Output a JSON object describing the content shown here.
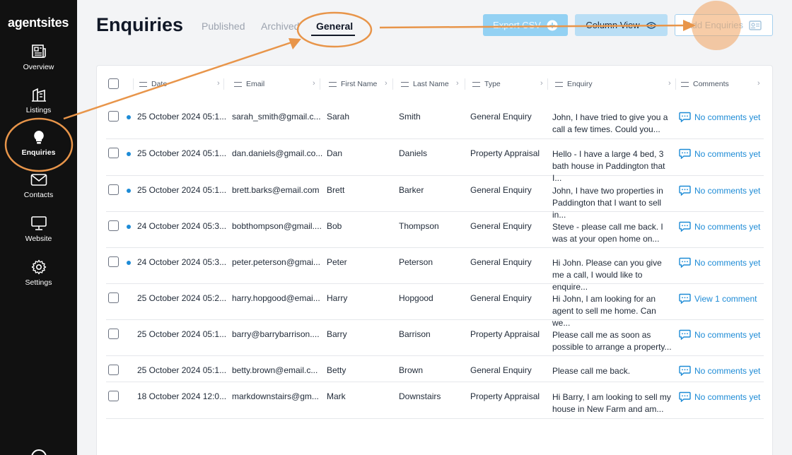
{
  "app": {
    "logo": "agentsites"
  },
  "sidebar": {
    "items": [
      {
        "label": "Overview",
        "icon": "newspaper-icon"
      },
      {
        "label": "Listings",
        "icon": "building-icon"
      },
      {
        "label": "Enquiries",
        "icon": "lightbulb-icon"
      },
      {
        "label": "Contacts",
        "icon": "envelope-icon"
      },
      {
        "label": "Website",
        "icon": "monitor-icon"
      },
      {
        "label": "Settings",
        "icon": "gear-icon"
      }
    ]
  },
  "header": {
    "title": "Enquiries",
    "tabs": [
      {
        "label": "Published"
      },
      {
        "label": "Archived"
      },
      {
        "label": "General"
      }
    ],
    "buttons": {
      "export": "Export CSV",
      "column_view": "Column View",
      "add": "Add Enquiries"
    }
  },
  "table": {
    "columns": [
      "Date",
      "Email",
      "First Name",
      "Last Name",
      "Type",
      "Enquiry",
      "Comments"
    ],
    "rows": [
      {
        "unread": true,
        "date": "25 October 2024 05:1...",
        "email": "sarah_smith@gmail.c...",
        "first": "Sarah",
        "last": "Smith",
        "type": "General Enquiry",
        "enquiry": "John, I have tried to give you a call a few times. Could you...",
        "comments": "No comments yet"
      },
      {
        "unread": true,
        "date": "25 October 2024 05:1...",
        "email": "dan.daniels@gmail.co...",
        "first": "Dan",
        "last": "Daniels",
        "type": "Property Appraisal",
        "enquiry": "Hello - I have a large 4 bed, 3 bath house in Paddington that I...",
        "comments": "No comments yet"
      },
      {
        "unread": true,
        "date": "25 October 2024 05:1...",
        "email": "brett.barks@email.com",
        "first": "Brett",
        "last": "Barker",
        "type": "General Enquiry",
        "enquiry": "John, I have two properties in Paddington that I want to sell in...",
        "comments": "No comments yet"
      },
      {
        "unread": true,
        "date": "24 October 2024 05:3...",
        "email": "bobthompson@gmail....",
        "first": "Bob",
        "last": "Thompson",
        "type": "General Enquiry",
        "enquiry": "Steve - please call me back. I was at your open home on...",
        "comments": "No comments yet"
      },
      {
        "unread": true,
        "date": "24 October 2024 05:3...",
        "email": "peter.peterson@gmai...",
        "first": "Peter",
        "last": "Peterson",
        "type": "General Enquiry",
        "enquiry": "Hi John. Please can you give me a call, I would like to enquire...",
        "comments": "No comments yet"
      },
      {
        "unread": false,
        "date": "25 October 2024 05:2...",
        "email": "harry.hopgood@emai...",
        "first": "Harry",
        "last": "Hopgood",
        "type": "General Enquiry",
        "enquiry": "Hi John, I am looking for an agent to sell me home. Can we...",
        "comments": "View 1 comment"
      },
      {
        "unread": false,
        "date": "25 October 2024 05:1...",
        "email": "barry@barrybarrison....",
        "first": "Barry",
        "last": "Barrison",
        "type": "Property Appraisal",
        "enquiry": "Please call me as soon as possible to arrange a property...",
        "comments": "No comments yet"
      },
      {
        "unread": false,
        "date": "25 October 2024 05:1...",
        "email": "betty.brown@email.c...",
        "first": "Betty",
        "last": "Brown",
        "type": "General Enquiry",
        "enquiry": "Please call me back.",
        "comments": "No comments yet"
      },
      {
        "unread": false,
        "date": "18 October 2024 12:0...",
        "email": "markdownstairs@gm...",
        "first": "Mark",
        "last": "Downstairs",
        "type": "Property Appraisal",
        "enquiry": "Hi Barry, I am looking to sell my house in New Farm and am...",
        "comments": "No comments yet"
      }
    ]
  },
  "colors": {
    "accent": "#1d8bd6",
    "annotation": "#e8954a",
    "sidebar": "#111111"
  }
}
